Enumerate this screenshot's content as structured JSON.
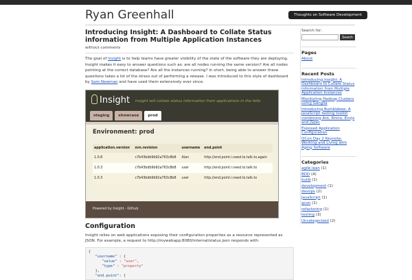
{
  "site": {
    "title": "Ryan Greenhall",
    "tagline": "Thoughts on Software Development"
  },
  "post": {
    "title": "Introducing Insight: A Dashboard to Collate Status information from Multiple Application Instances",
    "meta": "without comments",
    "para_pre": "The goal of ",
    "para_link1": "Insight",
    "para_mid": " is to help teams have greater visibility of the state of the software they are deploying. Insight makes it easy to answer questions such as: are all nodes running the same version? Are all nodes pointing at the correct database? Are all the instances running? In short, being able to answer these questions takes a lot of the stress out of performing a release.  I was introduced to this style of dashboard by ",
    "para_link2": "Sam Newman",
    "para_post": " and have used them extensively ever since."
  },
  "screenshot": {
    "logo": "Insight",
    "tagline": "Insight will collate status information from applications in the follo",
    "tabs": [
      "staging",
      "showcase",
      "prod"
    ],
    "env_title": "Environment: prod",
    "columns": [
      "application.version",
      "svn.revision",
      "username",
      "end.point"
    ],
    "rows": [
      [
        "1.0.8",
        "c7b43bdb9b92a763c8b8",
        "Alan",
        "http://end.point.i.need.to.talk.to.again"
      ],
      [
        "1.0.3",
        "c7b43bdb9b92a763c8b8",
        "user",
        "http://end.point.i.need.to.talk.to"
      ],
      [
        "1.0.3",
        "c7b43bdb9b92a763c8b8",
        "user",
        "http://end.point.i.need.to.talk.to"
      ]
    ],
    "footer": "Powered by Insight - Github"
  },
  "configuration": {
    "heading": "Configuration",
    "text": "Insight relies on web applications exposing their configuration properties as a resource represented as JSON.  For example, a request to http://mywebapp:8080/internal/status.json responds with:",
    "code": {
      "l1": "{",
      "l2_key": "\"username\"",
      "l3_key": "\"value\"",
      "l3_val": "\"user\"",
      "l4_key": "\"type\"",
      "l4_val": "\"property\"",
      "l5": "},",
      "l6_key": "\"end.point\""
    }
  },
  "sidebar": {
    "search_label": "Search for:",
    "search_value": "",
    "search_button": "Search",
    "pages_heading": "Pages",
    "pages": [
      "About"
    ],
    "recent_heading": "Recent Posts",
    "recent": [
      "Introducing Insight: A Dashboard to Collate Status information from Multiple Application Instances",
      "Monitoring Hadoop Clusters using Ganglia",
      "Introducing Bumblebee: A JavaScript testing toolkit combining Ant, Rhino, Envjs and JSpec",
      "Exposed Application Configuration",
      "QCon Day 2 Keynote: Working and Living with Aging Software"
    ],
    "categories_heading": "Categories",
    "categories": [
      {
        "name": "agile lean",
        "count": "(1)"
      },
      {
        "name": "BDD",
        "count": "(4)"
      },
      {
        "name": "build",
        "count": "(1)"
      },
      {
        "name": "development",
        "count": "(1)"
      },
      {
        "name": "devops",
        "count": "(2)"
      },
      {
        "name": "JavaScript",
        "count": "(1)"
      },
      {
        "name": "qcon",
        "count": "(1)"
      },
      {
        "name": "refactoring",
        "count": "(1)"
      },
      {
        "name": "testing",
        "count": "(3)"
      },
      {
        "name": "Uncategorized",
        "count": "(2)"
      }
    ]
  }
}
